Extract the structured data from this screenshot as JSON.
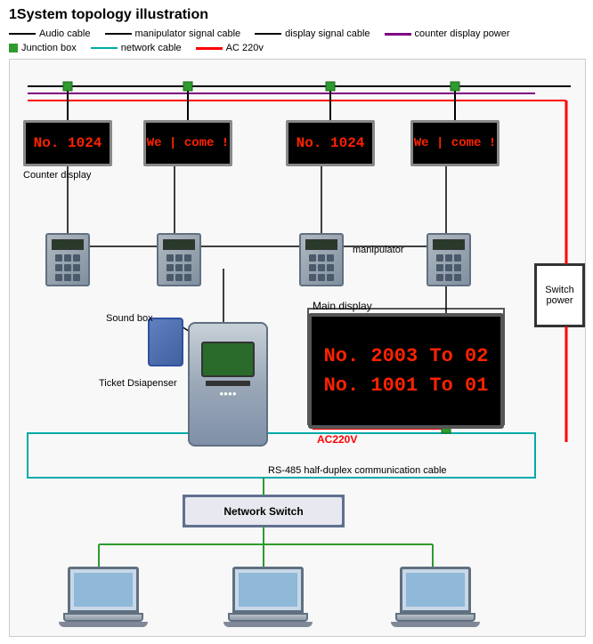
{
  "title": "1System topology illustration",
  "legend": {
    "audio_cable": "Audio cable",
    "counter_display_power": "counter display power",
    "manipulator_signal_cable": "manipulator signal cable",
    "junction_box": "Junction box",
    "display_signal_cable": "display signal cable",
    "network_cable": "network cable",
    "ac_label": "AC 220v"
  },
  "counter_displays": [
    {
      "id": 1,
      "text": "No. 1024"
    },
    {
      "id": 2,
      "text": "We | come !"
    },
    {
      "id": 3,
      "text": "No. 1024"
    },
    {
      "id": 4,
      "text": "We | come !"
    }
  ],
  "counter_display_label": "Counter display",
  "manipulator_label": "manipulator",
  "main_display": {
    "label": "Main display",
    "line1": "No. 2003 To 02",
    "line2": "No. 1001 To 01"
  },
  "sound_box_label": "Sound box",
  "ticket_dispenser_label": "Ticket Dsiapenser",
  "ac220v_label": "AC220V",
  "rs485_label": "RS-485 half-duplex communication cable",
  "network_switch_label": "Network Switch",
  "switch_power_label": "Switch\npower",
  "computers": [
    {
      "id": 1
    },
    {
      "id": 2
    },
    {
      "id": 3
    }
  ]
}
